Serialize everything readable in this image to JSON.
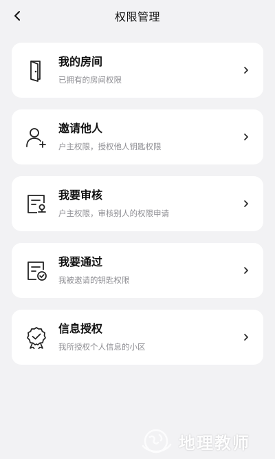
{
  "nav": {
    "title": "权限管理"
  },
  "cards": [
    {
      "title": "我的房间",
      "subtitle": "已拥有的房间权限",
      "icon": "door-icon"
    },
    {
      "title": "邀请他人",
      "subtitle": "户主权限，授权他人钥匙权限",
      "icon": "add-user-icon"
    },
    {
      "title": "我要审核",
      "subtitle": "户主权限，审核别人的权限申请",
      "icon": "review-certificate-icon"
    },
    {
      "title": "我要通过",
      "subtitle": "我被邀请的钥匙权限",
      "icon": "approved-document-icon"
    },
    {
      "title": "信息授权",
      "subtitle": "我所授权个人信息的小区",
      "icon": "authorization-badge-icon"
    }
  ],
  "watermark": {
    "text": "地理教师"
  }
}
